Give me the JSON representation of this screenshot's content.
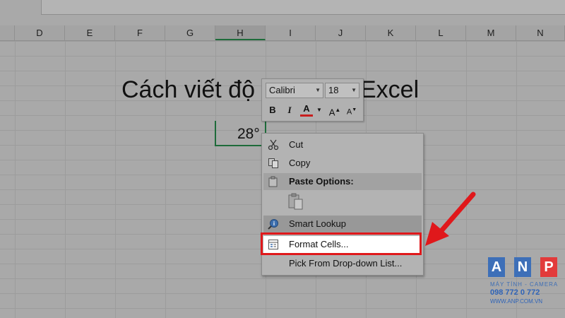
{
  "columns": [
    "D",
    "E",
    "F",
    "G",
    "H",
    "I",
    "J",
    "K",
    "L",
    "M",
    "N"
  ],
  "selected_column": "H",
  "sheet": {
    "title_left": "Cách viết độ",
    "title_right": "Excel",
    "cell_value": "28°"
  },
  "mini_toolbar": {
    "font_name": "Calibri",
    "font_size": "18",
    "bold": "B",
    "italic": "I",
    "font_color": "A",
    "grow_font": "A",
    "shrink_font": "A"
  },
  "context_menu": {
    "cut": "Cut",
    "copy": "Copy",
    "paste_options": "Paste Options:",
    "smart_lookup": "Smart Lookup",
    "format_cells": "Format Cells...",
    "pick_list": "Pick From Drop-down List..."
  },
  "logo": {
    "letters": [
      "A",
      "N",
      "P"
    ],
    "tagline": "MÁY TÍNH - CAMERA",
    "phone": "098 772 0 772",
    "website": "WWW.ANP.COM.VN"
  },
  "colors": {
    "accent_green": "#1e6b3a",
    "highlight_red": "#e0181b",
    "logo_blue": "#2f64b8",
    "logo_red": "#e23b3b"
  }
}
